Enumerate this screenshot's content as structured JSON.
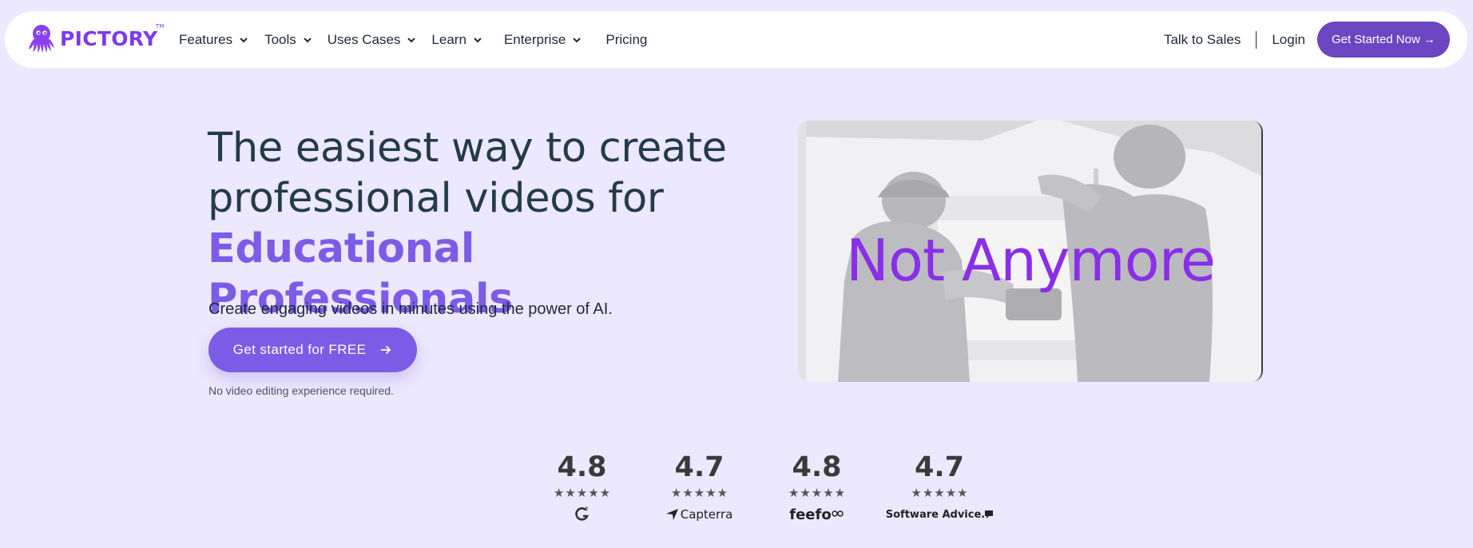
{
  "logo": {
    "text": "PICTORY",
    "tm": "TM"
  },
  "nav": {
    "items": [
      {
        "label": "Features",
        "dropdown": true
      },
      {
        "label": "Tools",
        "dropdown": true
      },
      {
        "label": "Uses Cases",
        "dropdown": true
      },
      {
        "label": "Learn",
        "dropdown": true
      },
      {
        "label": "Enterprise",
        "dropdown": true
      },
      {
        "label": "Pricing",
        "dropdown": false
      }
    ],
    "talk_to_sales": "Talk to Sales",
    "login": "Login",
    "get_started": "Get Started Now →"
  },
  "hero": {
    "title_line1": "The easiest way to create",
    "title_line2": "professional videos for",
    "title_accent": "Educational Professionals",
    "subtitle": "Create engaging videos in minutes using the power of AI.",
    "cta": "Get started for FREE",
    "note": "No video editing experience required."
  },
  "video": {
    "overlay_text": "Not Anymore"
  },
  "ratings": [
    {
      "score": "4.8",
      "stars": 5,
      "brand": "G2",
      "brand_icon": "g2-logo-icon"
    },
    {
      "score": "4.7",
      "stars": 5,
      "brand": "Capterra",
      "brand_icon": "capterra-logo-icon"
    },
    {
      "score": "4.8",
      "stars": 5,
      "brand": "feefo",
      "brand_icon": "feefo-logo-icon"
    },
    {
      "score": "4.7",
      "stars": 5,
      "brand": "Software Advice.",
      "brand_icon": "software-advice-logo-icon"
    }
  ],
  "colors": {
    "background": "#ece8fd",
    "brand_purple": "#7c3aed",
    "accent": "#7c5ce6",
    "cta_dark": "#6b46c1",
    "title": "#233c46",
    "overlay_text": "#8a2ee8"
  }
}
